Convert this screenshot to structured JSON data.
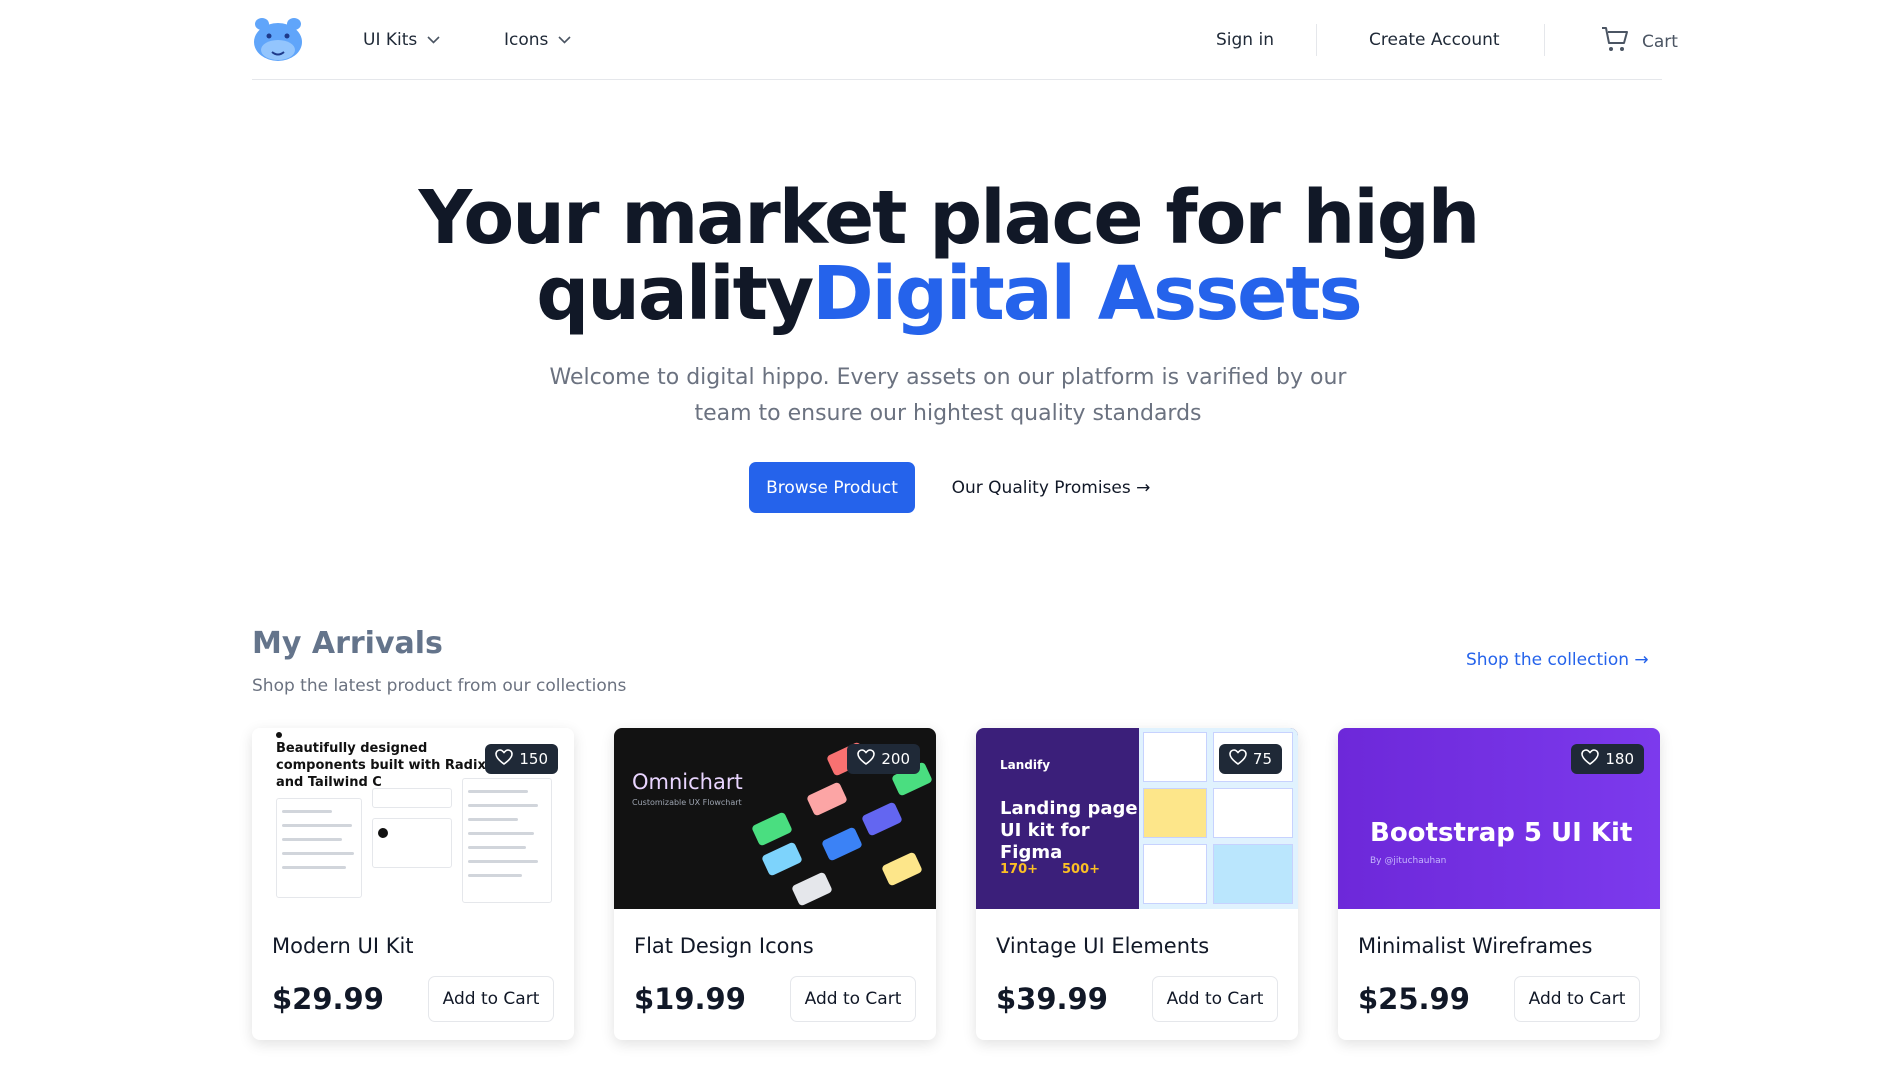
{
  "nav": {
    "menus": [
      {
        "label": "UI Kits"
      },
      {
        "label": "Icons"
      }
    ],
    "sign_in": "Sign in",
    "create_account": "Create Account",
    "cart": "Cart"
  },
  "hero": {
    "title_line1": "Your market place for high",
    "title_line2_plain": "quality",
    "title_line2_accent": "Digital Assets",
    "subtitle": "Welcome to digital hippo. Every assets on our platform is varified by our team to ensure our hightest quality standards",
    "primary_cta": "Browse Product",
    "secondary_cta": "Our Quality Promises →"
  },
  "arrivals": {
    "title": "My Arrivals",
    "subtitle": "Shop the latest product from our collections",
    "link": "Shop the collection →"
  },
  "products": [
    {
      "name": "Modern UI Kit",
      "price": "$29.99",
      "likes": "150",
      "add_label": "Add to Cart",
      "image_text": "Beautifully designed components built with RadixUI and Tailwind C"
    },
    {
      "name": "Flat Design Icons",
      "price": "$19.99",
      "likes": "200",
      "add_label": "Add to Cart",
      "image_title": "Omnichart",
      "image_sub": "Customizable UX Flowchart"
    },
    {
      "name": "Vintage UI Elements",
      "price": "$39.99",
      "likes": "75",
      "add_label": "Add to Cart",
      "image_brand": "Landify",
      "image_title": "Landing page UI kit for Figma",
      "image_stat1": "170+",
      "image_stat2": "500+"
    },
    {
      "name": "Minimalist Wireframes",
      "price": "$25.99",
      "likes": "180",
      "add_label": "Add to Cart",
      "image_title": "Bootstrap 5 UI Kit",
      "image_sub": "By @jituchauhan"
    }
  ],
  "colors": {
    "accent": "#2563eb",
    "text": "#111827",
    "muted": "#6b7280",
    "likes_badge": "#1f2937"
  }
}
